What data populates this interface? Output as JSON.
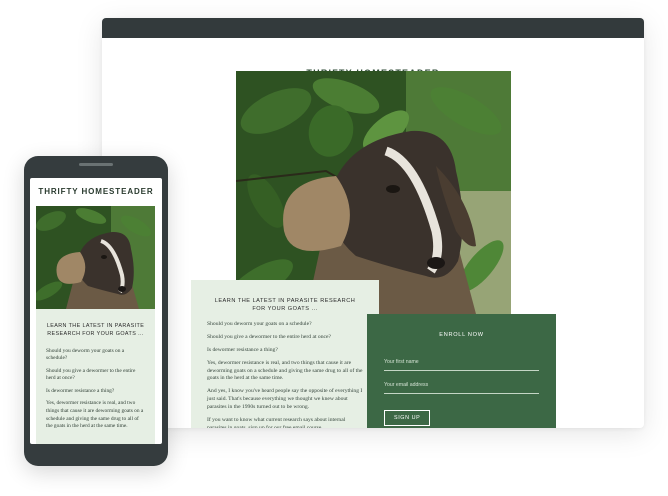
{
  "brand": "THRIFTY HOMESTEADER",
  "article": {
    "headline": "LEARN THE LATEST IN PARASITE RESEARCH FOR YOUR GOATS ...",
    "paragraphs": [
      "Should you deworm your goats on a schedule?",
      "Should you give a dewormer to the entire herd at once?",
      "Is dewormer resistance a thing?",
      "Yes, dewormer resistance is real, and two things that cause it are deworming goats on a schedule and giving the same drug to all of the goats in the herd at the same time.",
      "And yes, I know you've heard people say the opposite of everything I just said. That's because everything we thought we knew about parasites in the 1990s turned out to be wrong.",
      "If you want to know what current research says about internal parasites in goats, sign up for our free email course"
    ]
  },
  "enroll": {
    "title": "ENROLL NOW",
    "first_name_placeholder": "Your first name",
    "email_placeholder": "Your email address",
    "signup_label": "SIGN UP"
  },
  "photo": {
    "subject": "goat among leaves"
  },
  "colors": {
    "device_frame": "#333a3c",
    "article_bg": "#e6efe4",
    "enroll_bg": "#3c6845",
    "title_text": "#2d4a34"
  }
}
